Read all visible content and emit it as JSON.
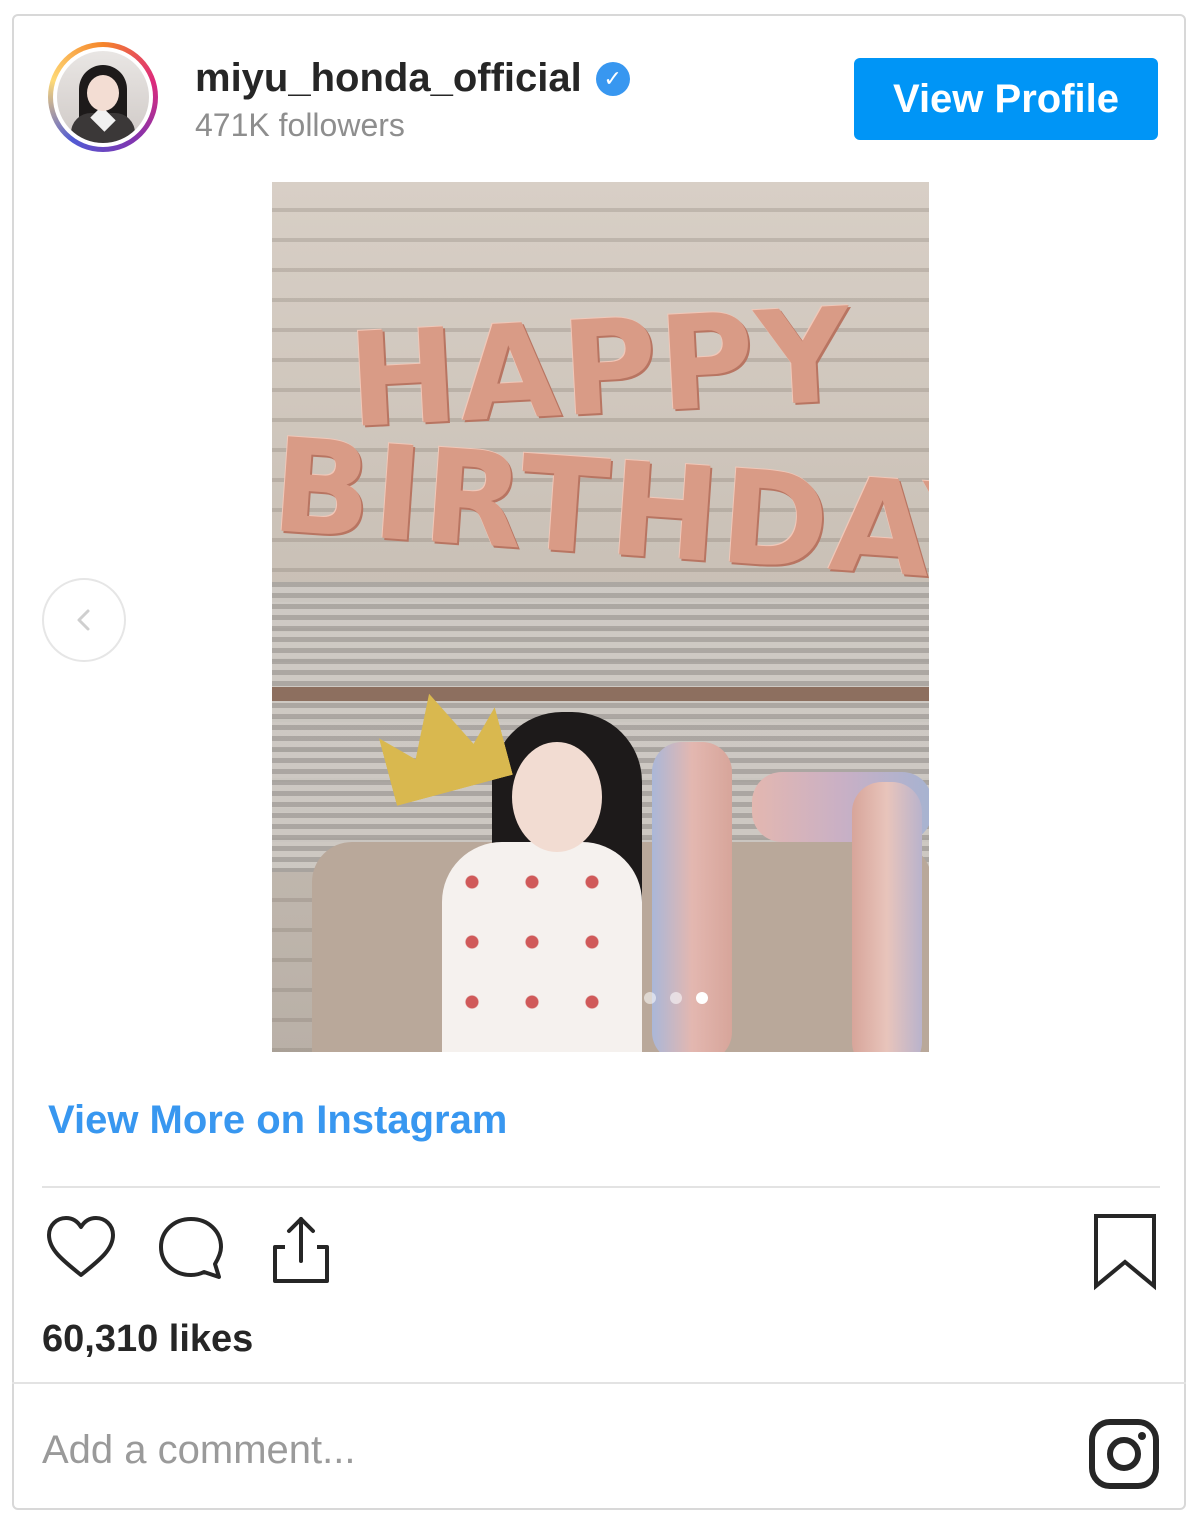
{
  "header": {
    "username": "miyu_honda_official",
    "followers": "471K followers",
    "view_profile_label": "View Profile",
    "verified_icon": "verified-check-icon"
  },
  "post": {
    "image_text_line1": "HAPPY",
    "image_text_line2": "BIRTHDAY",
    "carousel_total": 3,
    "carousel_active": 3,
    "view_more_label": "View More on Instagram",
    "likes": "60,310 likes"
  },
  "actions": {
    "icons": [
      "heart-icon",
      "comment-icon",
      "share-icon",
      "bookmark-icon"
    ]
  },
  "comment": {
    "placeholder": "Add a comment..."
  },
  "brand": {
    "accent": "#0095f6",
    "link": "#3897f0"
  }
}
